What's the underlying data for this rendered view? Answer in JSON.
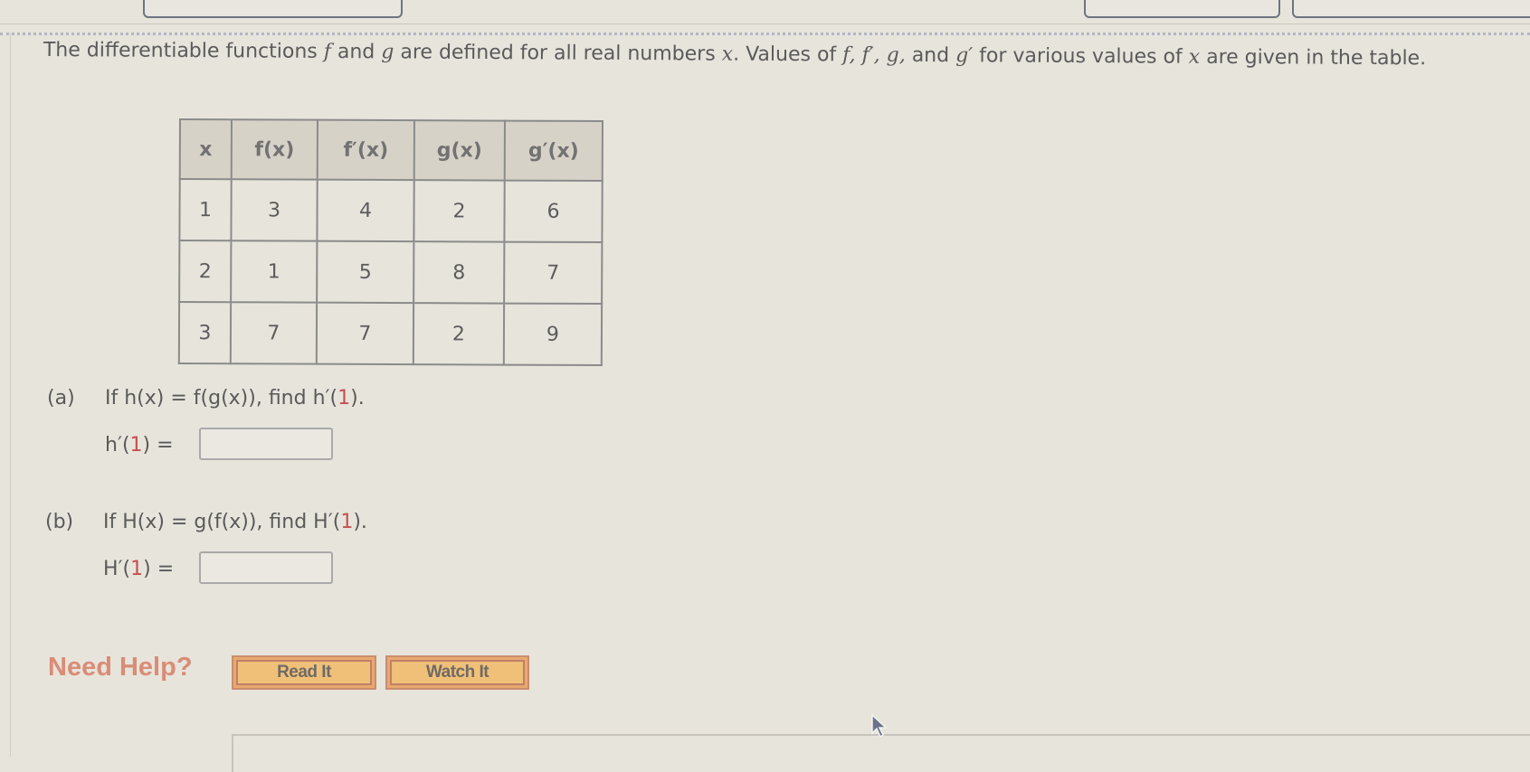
{
  "intro": {
    "p1": "The differentiable functions ",
    "f": "f",
    "p2": " and ",
    "g": "g",
    "p3": " are defined for all real numbers ",
    "x": "x",
    "p4": ". Values of ",
    "list": "f, f′, g,",
    "p5": " and ",
    "gp": "g′",
    "p6": " for various values of ",
    "x2": "x",
    "p7": " are given in the table."
  },
  "table": {
    "headers": [
      "x",
      "f(x)",
      "f′(x)",
      "g(x)",
      "g′(x)"
    ],
    "rows": [
      [
        "1",
        "3",
        "4",
        "2",
        "6"
      ],
      [
        "2",
        "1",
        "5",
        "8",
        "7"
      ],
      [
        "3",
        "7",
        "7",
        "2",
        "9"
      ]
    ]
  },
  "parts": [
    {
      "label": "(a)",
      "question_pre": "If h(x) = f(g(x)), find h′(",
      "question_num": "1",
      "question_post": ").",
      "answer_pre": "h′(",
      "answer_num": "1",
      "answer_post": ") =",
      "answer_value": ""
    },
    {
      "label": "(b)",
      "question_pre": "If H(x) = g(f(x)), find H′(",
      "question_num": "1",
      "question_post": ").",
      "answer_pre": "H′(",
      "answer_num": "1",
      "answer_post": ") =",
      "answer_value": ""
    }
  ],
  "help": {
    "label": "Need Help?",
    "read_it": "Read It",
    "watch_it": "Watch It"
  },
  "colors": {
    "highlight_number": "#c5504f",
    "need_help": "#d98d76",
    "help_button": "#f0c078"
  },
  "icons": {
    "cursor": "mouse-pointer-arrow"
  }
}
